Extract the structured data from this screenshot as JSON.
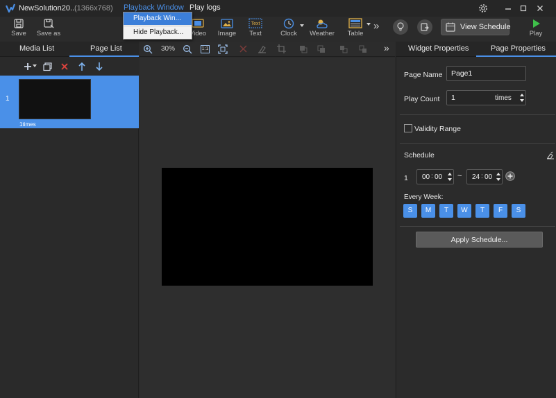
{
  "titlebar": {
    "app_title": "NewSolution20...",
    "resolution": "(1366x768)",
    "menus": [
      "Playback Window",
      "Play logs"
    ],
    "window_buttons": [
      "gear-icon",
      "minimize-icon",
      "maximize-icon",
      "close-icon"
    ]
  },
  "dropdown": {
    "items": [
      "Playback Win...",
      "Hide Playback..."
    ]
  },
  "toolbar": {
    "save": "Save",
    "save_as": "Save as",
    "video": "Video",
    "image": "Image",
    "text": "Text",
    "clock": "Clock",
    "weather": "Weather",
    "table": "Table",
    "more": "»",
    "view_schedule": "View Schedule",
    "play": "Play"
  },
  "left_panel": {
    "tabs": [
      "Media List",
      "Page List"
    ],
    "active_tab": "Page List",
    "tool_icons": [
      "add-icon",
      "copy-icon",
      "delete-icon",
      "move-up-icon",
      "move-down-icon"
    ],
    "pages": [
      {
        "index": "1",
        "caption": "1times"
      }
    ]
  },
  "canvas_toolbar": {
    "zoom": "30%",
    "ratio_label": "1:1",
    "more": "»"
  },
  "right_panel": {
    "tabs": [
      "Widget Properties",
      "Page Properties"
    ],
    "active_tab": "Page Properties",
    "page_name_label": "Page Name",
    "page_name_value": "Page1",
    "play_count_label": "Play Count",
    "play_count_value": "1",
    "play_count_unit": "times",
    "validity_range_label": "Validity Range",
    "validity_range_checked": false,
    "schedule_label": "Schedule",
    "schedule_rows": [
      {
        "index": "1",
        "start_hour": "00",
        "start_min": "00",
        "separator": "~",
        "end_hour": "24",
        "end_min": "00"
      }
    ],
    "every_week_label": "Every Week:",
    "weekdays": [
      "S",
      "M",
      "T",
      "W",
      "T",
      "F",
      "S"
    ],
    "apply_schedule": "Apply Schedule..."
  },
  "colors": {
    "accent": "#4a90e8",
    "menu_active": "#4a8fe6",
    "background": "#2b2b2b"
  }
}
